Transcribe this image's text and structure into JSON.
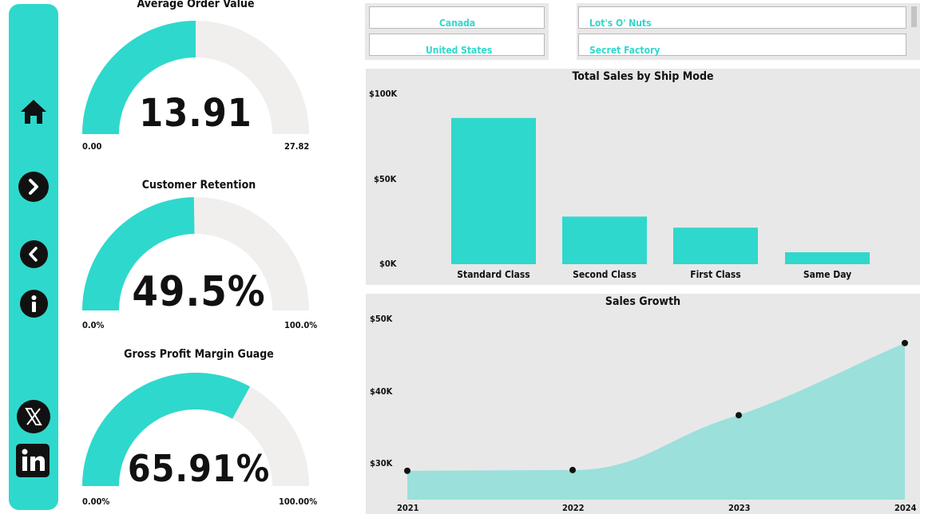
{
  "sidebar": {
    "buttons": [
      {
        "icon": "home-icon"
      },
      {
        "icon": "chevron-right-icon"
      },
      {
        "icon": "chevron-left-icon"
      },
      {
        "icon": "info-icon"
      },
      {
        "icon": "x-logo-icon"
      },
      {
        "icon": "linkedin-icon"
      }
    ]
  },
  "gauges": [
    {
      "title": "Average Order Value",
      "value": "13.91",
      "min": "0.00",
      "max": "27.82",
      "fraction": 0.5
    },
    {
      "title": "Customer Retention",
      "value": "49.5%",
      "min": "0.0%",
      "max": "100.0%",
      "fraction": 0.495
    },
    {
      "title": "Gross Profit Margin Guage",
      "value": "65.91%",
      "min": "0.00%",
      "max": "100.00%",
      "fraction": 0.6591
    }
  ],
  "slicers": {
    "countries": [
      "Canada",
      "United States"
    ],
    "factories": [
      "Lot's O' Nuts",
      "Secret Factory"
    ]
  },
  "colors": {
    "accent": "#2fd8cc",
    "area": "#9be0da",
    "track": "#f0efee",
    "panel": "#e8e8e8"
  },
  "chart_data": [
    {
      "type": "bar",
      "title": "Total Sales by Ship Mode",
      "categories": [
        "Standard Class",
        "Second Class",
        "First Class",
        "Same Day"
      ],
      "values": [
        86000,
        28000,
        21500,
        7000
      ],
      "yticks": [
        "$0K",
        "$50K",
        "$100K"
      ],
      "ylim": [
        0,
        100000
      ]
    },
    {
      "type": "area",
      "title": "Sales Growth",
      "x": [
        "2021",
        "2022",
        "2023",
        "2024"
      ],
      "values": [
        29000,
        29100,
        36700,
        46700
      ],
      "yticks": [
        "$30K",
        "$40K",
        "$50K"
      ],
      "ylim": [
        25000,
        50000
      ]
    }
  ]
}
